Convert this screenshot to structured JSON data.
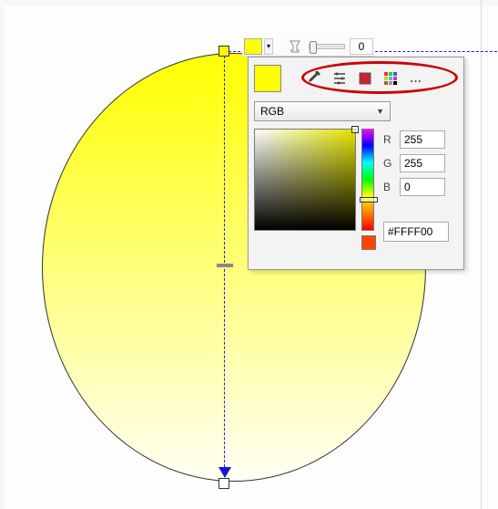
{
  "toolbar": {
    "swatch_color": "#FFFF00",
    "slider_value": "0"
  },
  "panel": {
    "swatch_color": "#FFFF00",
    "tools": {
      "eyedropper": "eyedropper-icon",
      "sliders": "sliders-icon",
      "swatch": "swatch-tool-icon",
      "palette": "palette-icon",
      "more": "..."
    },
    "mode_label": "RGB",
    "r_label": "R",
    "g_label": "G",
    "b_label": "B",
    "r_value": "255",
    "g_value": "255",
    "b_value": "0",
    "hex_value": "#FFFF00"
  }
}
